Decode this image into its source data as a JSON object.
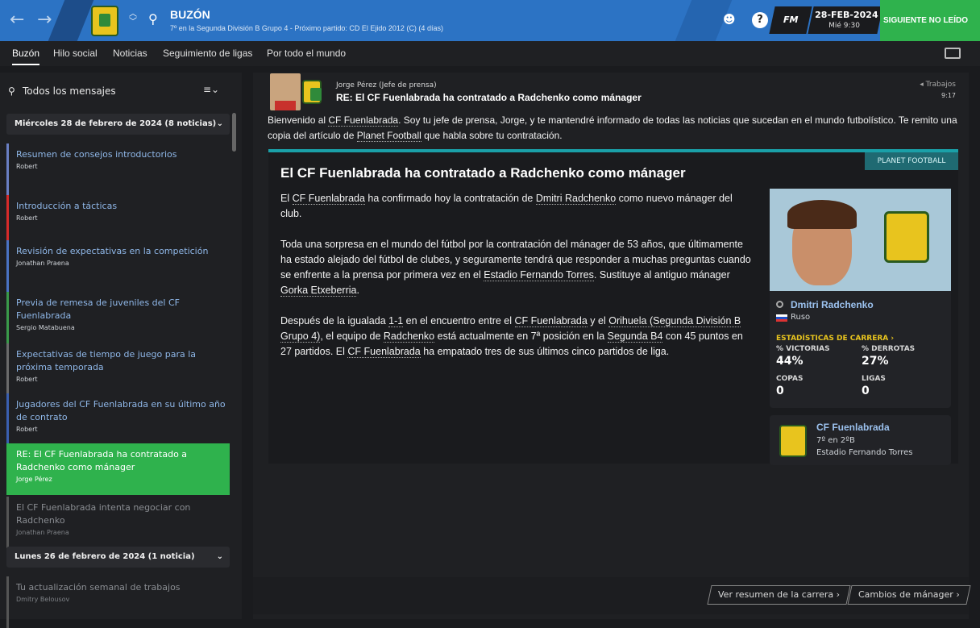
{
  "header": {
    "title": "BUZÓN",
    "subtitle": "7º en la Segunda División B Grupo 4 - Próximo partido: CD El Ejido 2012 (C)  (4 días)",
    "date": "28-FEB-2024",
    "day_time": "Mié 9:30",
    "next_button": "SIGUIENTE NO LEÍDO",
    "fm_label": "FM",
    "help_icon": "?"
  },
  "tabs": [
    "Buzón",
    "Hilo social",
    "Noticias",
    "Seguimiento de ligas",
    "Por todo el mundo"
  ],
  "sidebar": {
    "search_label": "Todos los mensajes",
    "groups": [
      {
        "label": "Miércoles 28 de febrero de 2024 (8 noticias)"
      },
      {
        "label": "Lunes 26 de febrero de 2024 (1 noticia)"
      }
    ],
    "items": [
      {
        "subject": "Resumen de consejos introductorios",
        "from": "Robert"
      },
      {
        "subject": "Introducción a tácticas",
        "from": "Robert"
      },
      {
        "subject": "Revisión de expectativas en la competición",
        "from": "Jonathan Praena"
      },
      {
        "subject": "Previa de remesa de juveniles del CF Fuenlabrada",
        "from": "Sergio Matabuena"
      },
      {
        "subject": "Expectativas de tiempo de juego para la próxima temporada",
        "from": "Robert"
      },
      {
        "subject": "Jugadores del CF Fuenlabrada en su último año de contrato",
        "from": "Robert"
      },
      {
        "subject": "RE: El CF Fuenlabrada ha contratado a Radchenko como mánager",
        "from": "Jorge Pérez"
      },
      {
        "subject": "El CF Fuenlabrada intenta negociar con Radchenko",
        "from": "Jonathan Praena"
      },
      {
        "subject": "Tu actualización semanal de trabajos",
        "from": "Dmitry Belousov"
      }
    ],
    "bar_colors": [
      "#6a7fc4",
      "#d62a2a",
      "#4a73c4",
      "#3a9a4a",
      "#6b6b6b",
      "#3a5fb0",
      "#2fb24d",
      "#555",
      "#555"
    ]
  },
  "message": {
    "sender": "Jorge Pérez  (Jefe de prensa)",
    "subject": "RE: El CF Fuenlabrada ha contratado a Radchenko como mánager",
    "tag": "Trabajos",
    "time": "9:17",
    "body_1": "Bienvenido al ",
    "body_link1": "CF Fuenlabrada",
    "body_2": ". Soy tu jefe de prensa, Jorge, y te mantendré informado de todas las noticias que sucedan en el mundo futbolístico. Te remito una copia del artículo de ",
    "body_link2": "Planet Football",
    "body_3": " que habla sobre tu contratación."
  },
  "article": {
    "source": "PLANET FOOTBALL",
    "title": "El CF Fuenlabrada ha contratado a Radchenko como mánager",
    "p1_a": "El ",
    "p1_l1": "CF Fuenlabrada",
    "p1_b": " ha confirmado hoy la contratación de ",
    "p1_l2": "Dmitri Radchenko",
    "p1_c": " como nuevo mánager del club.",
    "p2_a": "Toda una sorpresa en el mundo del fútbol por la contratación del mánager de 53 años, que últimamente ha estado alejado del fútbol de clubes, y seguramente tendrá que responder a muchas preguntas cuando se enfrente a la prensa por primera vez en el ",
    "p2_l1": "Estadio Fernando Torres",
    "p2_b": ". Sustituye al antiguo mánager ",
    "p2_l2": "Gorka Etxeberria",
    "p2_c": ".",
    "p3_a": "Después de la igualada ",
    "p3_l1": "1-1",
    "p3_b": " en el encuentro entre el ",
    "p3_l2": "CF Fuenlabrada",
    "p3_c": " y el ",
    "p3_l3": "Orihuela (Segunda División B Grupo 4)",
    "p3_d": ", el equipo de ",
    "p3_l4": "Radchenko",
    "p3_e": " está actualmente en 7ª posición en la ",
    "p3_l5": "Segunda B4",
    "p3_f": " con 45 puntos en 27 partidos. El ",
    "p3_l6": "CF Fuenlabrada",
    "p3_g": " ha empatado tres de sus últimos cinco partidos de liga."
  },
  "person": {
    "name": "Dmitri Radchenko",
    "nationality": "Ruso",
    "stats_header": "ESTADÍSTICAS DE CARRERA ›",
    "win_label": "% VICTORIAS",
    "win_value": "44%",
    "loss_label": "% DERROTAS",
    "loss_value": "27%",
    "cups_label": "COPAS",
    "cups_value": "0",
    "leagues_label": "LIGAS",
    "leagues_value": "0"
  },
  "club": {
    "name": "CF Fuenlabrada",
    "position": "7º en 2ºB",
    "stadium": "Estadio Fernando Torres"
  },
  "footer": {
    "career_button": "Ver resumen de la carrera ›",
    "changes_button": "Cambios de mánager ›"
  }
}
